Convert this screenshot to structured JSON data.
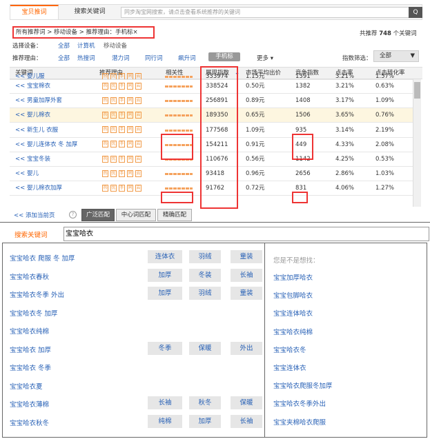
{
  "tabs": {
    "active": "宝贝推词",
    "other": "搜索关键词"
  },
  "search": {
    "placeholder": "同步淘宝网搜索，请点击查看系统推荐的关键词",
    "button": "Q"
  },
  "breadcrumb": "所有推荐词 > 移动设备 > 推荐理由：手机标×",
  "total": {
    "prefix": "共推荐",
    "count": "748",
    "suffix": "个关键词"
  },
  "filters": {
    "device_label": "选择设备：",
    "devices": [
      "全部",
      "计算机",
      "移动设备"
    ],
    "reason_label": "推荐理由：",
    "reasons": [
      "全部",
      "热搜词",
      "潜力词",
      "同行词",
      "飙升词",
      "手机标"
    ],
    "more": "更多",
    "index_label": "指数筛选：",
    "index_value": "全部"
  },
  "columns": [
    "关键词",
    "推荐理由",
    "相关性",
    "展现指数",
    "市场平均出价",
    "竞争指数",
    "点击率",
    "点击转化率"
  ],
  "rows": [
    {
      "kw": "<< 婴儿服",
      "show": "333974",
      "bid": "1.15元",
      "comp": "1391",
      "ctr": "3.21%",
      "cvr": "1.57%"
    },
    {
      "kw": "<< 宝宝棉衣",
      "show": "338524",
      "bid": "0.50元",
      "comp": "1382",
      "ctr": "3.21%",
      "cvr": "0.63%"
    },
    {
      "kw": "<< 男童加厚外套",
      "show": "256891",
      "bid": "0.89元",
      "comp": "1408",
      "ctr": "3.17%",
      "cvr": "1.09%"
    },
    {
      "kw": "<< 婴儿棉衣",
      "show": "189350",
      "bid": "0.65元",
      "comp": "1506",
      "ctr": "3.65%",
      "cvr": "0.76%"
    },
    {
      "kw": "<< 新生儿 衣服",
      "show": "177568",
      "bid": "1.09元",
      "comp": "935",
      "ctr": "3.14%",
      "cvr": "2.19%"
    },
    {
      "kw": "<< 婴儿连体衣 冬 加厚",
      "show": "154211",
      "bid": "0.91元",
      "comp": "449",
      "ctr": "4.33%",
      "cvr": "2.08%"
    },
    {
      "kw": "<< 宝宝冬装",
      "show": "110676",
      "bid": "0.56元",
      "comp": "1142",
      "ctr": "4.25%",
      "cvr": "0.53%"
    },
    {
      "kw": "<< 婴儿",
      "show": "93418",
      "bid": "0.96元",
      "comp": "2656",
      "ctr": "2.86%",
      "cvr": "1.03%"
    },
    {
      "kw": "<< 婴儿棉衣加厚",
      "show": "91762",
      "bid": "0.72元",
      "comp": "831",
      "ctr": "4.06%",
      "cvr": "1.27%"
    }
  ],
  "reason_badges": [
    "热",
    "优",
    "手",
    "同",
    "云"
  ],
  "footer": {
    "add": "<< 添加当前页",
    "matches": [
      "广泛匹配",
      "中心词匹配",
      "精确匹配"
    ]
  },
  "search2": {
    "label": "搜索关键词",
    "value": "宝宝哈衣"
  },
  "suggestions": [
    {
      "text": "宝宝哈衣 爬服 冬 加厚",
      "chips": [
        "连体衣",
        "羽绒",
        "童装"
      ]
    },
    {
      "text": "宝宝哈衣春秋",
      "chips": [
        "加厚",
        "冬装",
        "长袖"
      ]
    },
    {
      "text": "宝宝哈衣冬季 外出",
      "chips": [
        "加厚",
        "羽绒",
        "童装"
      ]
    },
    {
      "text": "宝宝哈衣冬 加厚",
      "chips": []
    },
    {
      "text": "宝宝哈衣纯棉",
      "chips": []
    },
    {
      "text": "宝宝哈衣 加厚",
      "chips": [
        "冬季",
        "保暖",
        "外出"
      ]
    },
    {
      "text": "宝宝哈衣 冬季",
      "chips": []
    },
    {
      "text": "宝宝哈衣夏",
      "chips": []
    },
    {
      "text": "宝宝哈衣薄棉",
      "chips": [
        "长袖",
        "秋冬",
        "保暖"
      ]
    },
    {
      "text": "宝宝哈衣秋冬",
      "chips": [
        "纯棉",
        "加厚",
        "长袖"
      ]
    }
  ],
  "related": {
    "title": "您是不是想找：",
    "items": [
      "宝宝加厚哈衣",
      "宝宝包脚哈衣",
      "宝宝连体哈衣",
      "宝宝哈衣纯棉",
      "宝宝哈衣冬",
      "宝宝连体衣",
      "宝宝哈衣爬服冬加厚",
      "宝宝哈衣冬季外出",
      "宝宝夹棉哈衣爬服"
    ]
  }
}
